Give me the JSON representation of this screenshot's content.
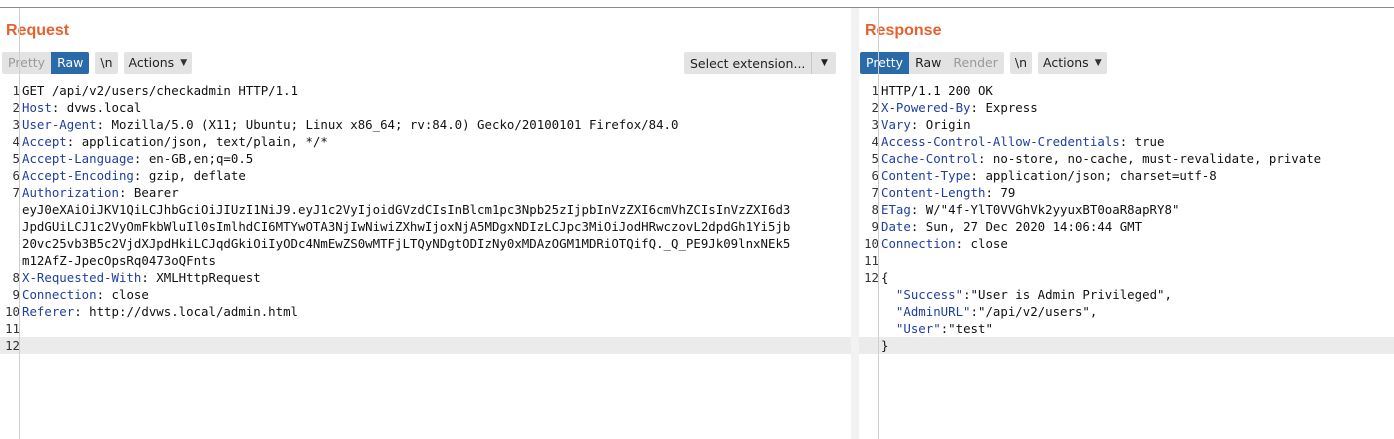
{
  "request": {
    "title": "Request",
    "view_tabs": [
      "Pretty",
      "Raw"
    ],
    "active_tab": "Raw",
    "newline_label": "\\n",
    "actions_label": "Actions",
    "extension_select": "Select extension...",
    "lines": [
      {
        "num": "1",
        "key": "",
        "sep": "",
        "value": "GET /api/v2/users/checkadmin HTTP/1.1"
      },
      {
        "num": "2",
        "key": "Host",
        "sep": ": ",
        "value": "dvws.local"
      },
      {
        "num": "3",
        "key": "User-Agent",
        "sep": ": ",
        "value": "Mozilla/5.0 (X11; Ubuntu; Linux x86_64; rv:84.0) Gecko/20100101 Firefox/84.0"
      },
      {
        "num": "4",
        "key": "Accept",
        "sep": ": ",
        "value": "application/json, text/plain, */*"
      },
      {
        "num": "5",
        "key": "Accept-Language",
        "sep": ": ",
        "value": "en-GB,en;q=0.5"
      },
      {
        "num": "6",
        "key": "Accept-Encoding",
        "sep": ": ",
        "value": "gzip, deflate"
      },
      {
        "num": "7",
        "key": "Authorization",
        "sep": ": ",
        "value": "Bearer"
      },
      {
        "num": "",
        "key": "",
        "sep": "",
        "value": "eyJ0eXAiOiJKV1QiLCJhbGciOiJIUzI1NiJ9.eyJ1c2VyIjoidGVzdCIsInBlcm1pc3Npb25zIjpbInVzZXI6cmVhZCIsInVzZXI6d3"
      },
      {
        "num": "",
        "key": "",
        "sep": "",
        "value": "JpdGUiLCJ1c2VyOmFkbWluIl0sImlhdCI6MTYwOTA3NjIwNiwiZXhwIjoxNjA5MDgxNDIzLCJpc3MiOiJodHRwczovL2dpdGh1Yi5jb"
      },
      {
        "num": "",
        "key": "",
        "sep": "",
        "value": "20vc25vb3B5c2VjdXJpdHkiLCJqdGkiOiIyODc4NmEwZS0wMTFjLTQyNDgtODIzNy0xMDAzOGM1MDRiOTQifQ._Q_PE9Jk09lnxNEk5"
      },
      {
        "num": "",
        "key": "",
        "sep": "",
        "value": "m12AfZ-JpecOpsRq0473oQFnts"
      },
      {
        "num": "8",
        "key": "X-Requested-With",
        "sep": ": ",
        "value": "XMLHttpRequest"
      },
      {
        "num": "9",
        "key": "Connection",
        "sep": ": ",
        "value": "close"
      },
      {
        "num": "10",
        "key": "Referer",
        "sep": ": ",
        "value": "http://dvws.local/admin.html"
      },
      {
        "num": "11",
        "key": "",
        "sep": "",
        "value": ""
      },
      {
        "num": "12",
        "key": "",
        "sep": "",
        "value": ""
      }
    ]
  },
  "response": {
    "title": "Response",
    "view_tabs": [
      "Pretty",
      "Raw",
      "Render"
    ],
    "active_tab": "Pretty",
    "newline_label": "\\n",
    "actions_label": "Actions",
    "lines": [
      {
        "num": "1",
        "key": "",
        "sep": "",
        "value": "HTTP/1.1 200 OK"
      },
      {
        "num": "2",
        "key": "X-Powered-By",
        "sep": ": ",
        "value": "Express"
      },
      {
        "num": "3",
        "key": "Vary",
        "sep": ": ",
        "value": "Origin"
      },
      {
        "num": "4",
        "key": "Access-Control-Allow-Credentials",
        "sep": ": ",
        "value": "true"
      },
      {
        "num": "5",
        "key": "Cache-Control",
        "sep": ": ",
        "value": "no-store, no-cache, must-revalidate, private"
      },
      {
        "num": "6",
        "key": "Content-Type",
        "sep": ": ",
        "value": "application/json; charset=utf-8"
      },
      {
        "num": "7",
        "key": "Content-Length",
        "sep": ": ",
        "value": "79"
      },
      {
        "num": "8",
        "key": "ETag",
        "sep": ": ",
        "value": "W/\"4f-YlT0VVGhVk2yyuxBT0oaR8apRY8\""
      },
      {
        "num": "9",
        "key": "Date",
        "sep": ": ",
        "value": "Sun, 27 Dec 2020 14:06:44 GMT"
      },
      {
        "num": "10",
        "key": "Connection",
        "sep": ": ",
        "value": "close"
      },
      {
        "num": "11",
        "key": "",
        "sep": "",
        "value": ""
      },
      {
        "num": "12",
        "key": "",
        "sep": "",
        "value": "{"
      },
      {
        "num": "",
        "key": "  \"Success\"",
        "sep": ":",
        "value": "\"User is Admin Privileged\","
      },
      {
        "num": "",
        "key": "  \"AdminURL\"",
        "sep": ":",
        "value": "\"/api/v2/users\","
      },
      {
        "num": "",
        "key": "  \"User\"",
        "sep": ":",
        "value": "\"test\""
      },
      {
        "num": "",
        "key": "",
        "sep": "",
        "value": "}"
      }
    ]
  },
  "colors": {
    "title": "#e8612c",
    "active_tab": "#2a6aa8",
    "header_key": "#1f3fa0"
  }
}
